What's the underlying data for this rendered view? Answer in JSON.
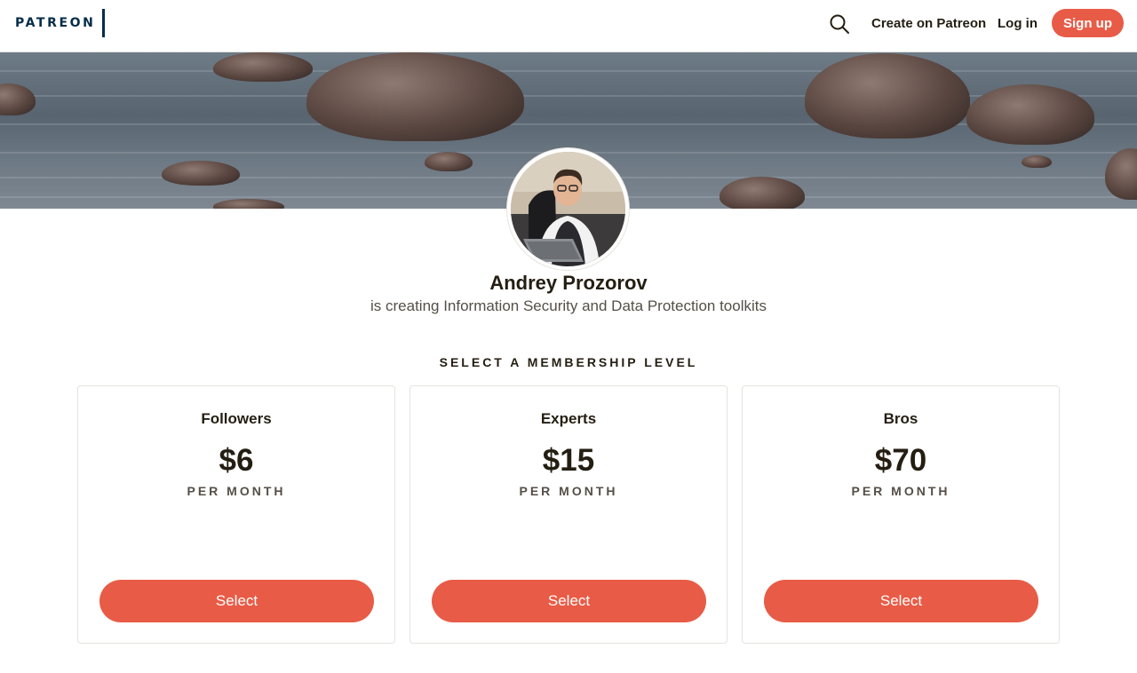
{
  "header": {
    "logo_text": "PATREON",
    "search_icon": "search-icon",
    "create_label": "Create on Patreon",
    "login_label": "Log in",
    "signup_label": "Sign up"
  },
  "creator": {
    "name": "Andrey Prozorov",
    "description": "is creating Information Security and Data Protection toolkits"
  },
  "membership": {
    "title": "SELECT A MEMBERSHIP LEVEL",
    "tiers": [
      {
        "name": "Followers",
        "price": "$6",
        "period": "PER MONTH",
        "button": "Select"
      },
      {
        "name": "Experts",
        "price": "$15",
        "period": "PER MONTH",
        "button": "Select"
      },
      {
        "name": "Bros",
        "price": "$70",
        "period": "PER MONTH",
        "button": "Select"
      }
    ]
  },
  "colors": {
    "accent": "#e85b46",
    "brand": "#052d49",
    "text": "#241e12"
  }
}
